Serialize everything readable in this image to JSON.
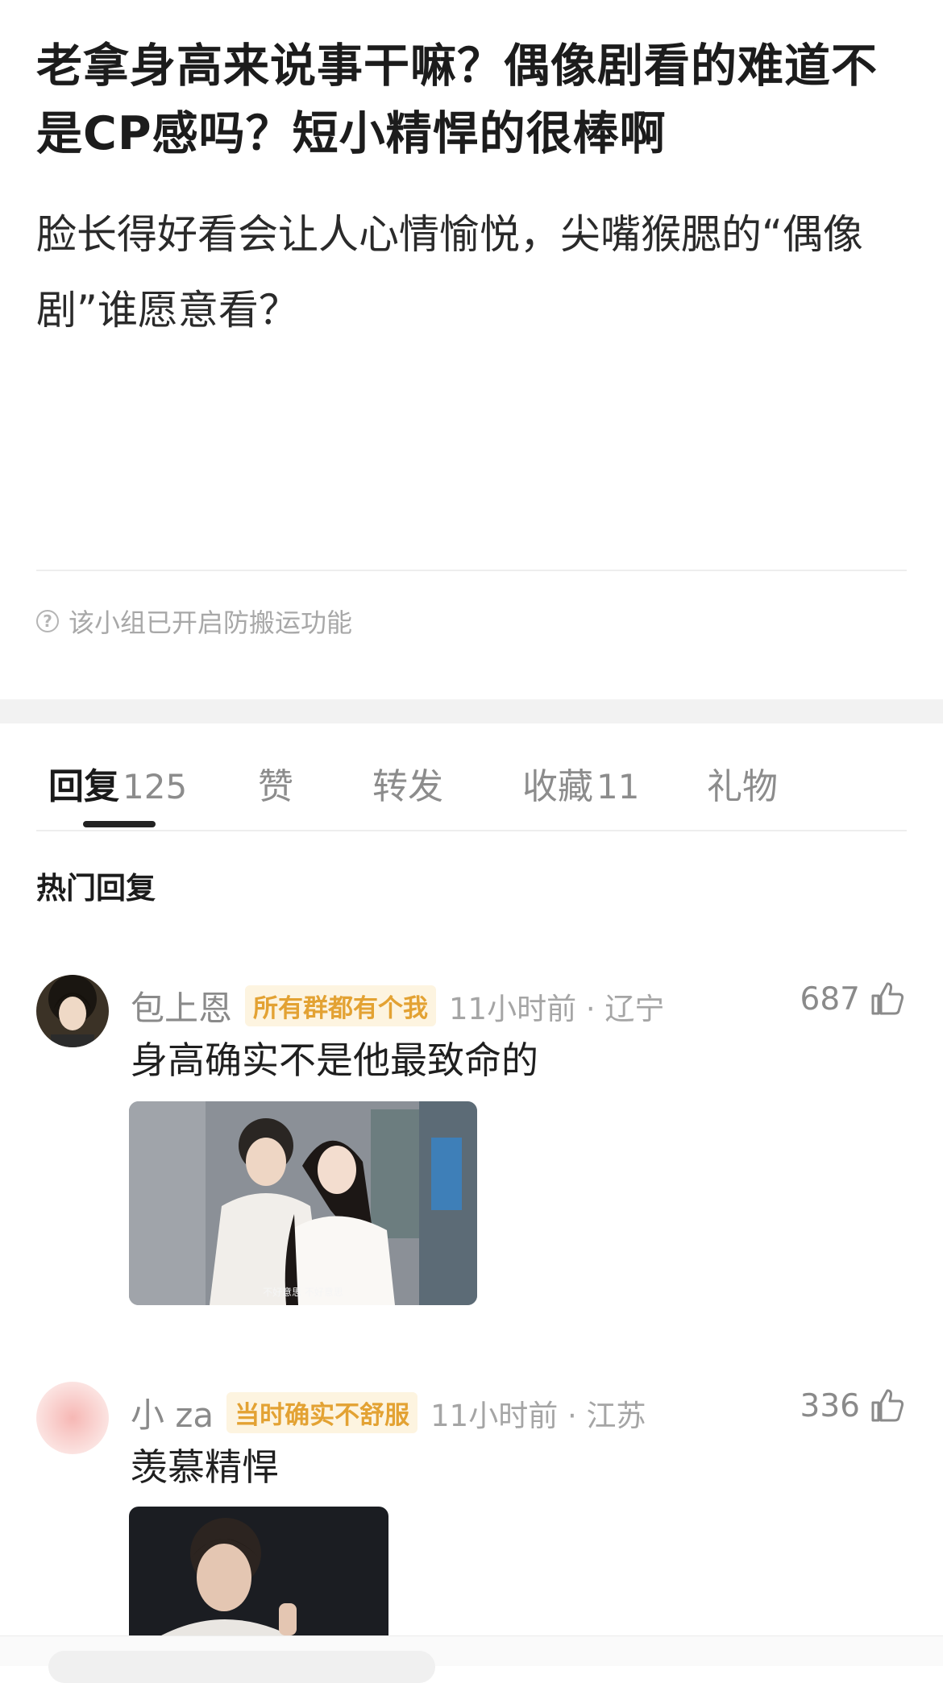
{
  "post": {
    "title": "老拿身高来说事干嘛？偶像剧看的难道不是CP感吗？短小精悍的很棒啊",
    "body": "脸长得好看会让人心情愉悦，尖嘴猴腮的“偶像剧”谁愿意看？",
    "notice": "该小组已开启防搬运功能",
    "notice_icon": "question-circle-icon"
  },
  "tabs": [
    {
      "label": "回复",
      "count": "125",
      "active": true
    },
    {
      "label": "赞",
      "count": ""
    },
    {
      "label": "转发",
      "count": ""
    },
    {
      "label": "收藏",
      "count": "11"
    },
    {
      "label": "礼物",
      "count": ""
    }
  ],
  "hot_replies_title": "热门回复",
  "comments": [
    {
      "username": "包上恩",
      "badge": "所有群都有个我",
      "time": "11小时前 · 辽宁",
      "likes": "687",
      "text": "身高确实不是他最致命的",
      "image_caption": "不好意思 不好意思"
    },
    {
      "username": "小 za",
      "badge": "当时确实不舒服",
      "time": "11小时前 · 江苏",
      "likes": "336",
      "text": "羡慕精悍"
    }
  ],
  "colors": {
    "badge_text": "#e3a233",
    "badge_bg": "#fdf4e0",
    "tab_underline": "#222222",
    "muted": "#8a8a8a"
  }
}
